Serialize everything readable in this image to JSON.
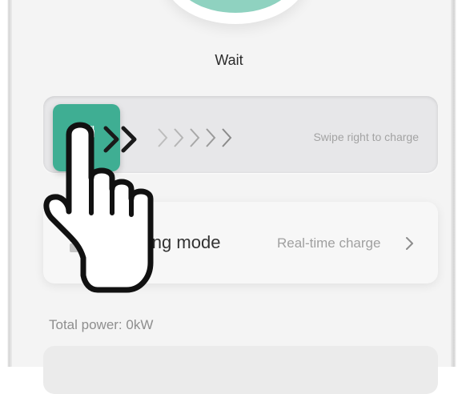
{
  "status": {
    "label": "Wait"
  },
  "swipe": {
    "hint": "Swipe right to charge"
  },
  "charging_mode": {
    "label": "Charging mode",
    "value": "Real-time charge"
  },
  "power": {
    "label": "Total power:",
    "value": "0kW",
    "text": "Total power:  0kW"
  },
  "colors": {
    "accent": "#3fae93",
    "accent_light": "#8fd2c0",
    "text_primary": "#333333",
    "text_secondary": "#a0a0a0"
  },
  "icons": [
    "plug-icon",
    "swipe-arrows-icon",
    "grid-icon",
    "chevron-right-icon",
    "tap-hand-icon"
  ]
}
